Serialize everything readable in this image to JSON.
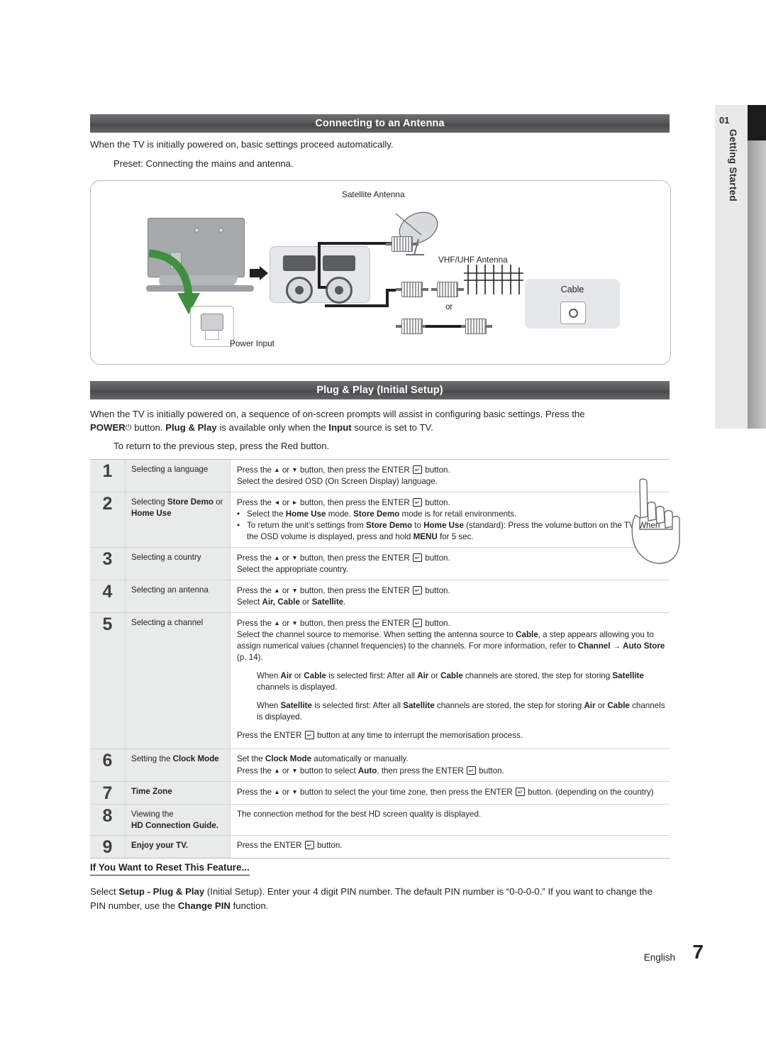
{
  "chapter": {
    "number": "01",
    "label": "Getting Started"
  },
  "sections": {
    "antenna": {
      "title": "Connecting to an Antenna",
      "intro": "When the TV is initially powered on, basic settings proceed automatically.",
      "preset": "Preset: Connecting the mains and antenna.",
      "diagram": {
        "satellite_antenna": "Satellite Antenna",
        "vhf_uhf_antenna": "VHF/UHF Antenna",
        "cable": "Cable",
        "power_input": "Power Input",
        "or": "or"
      }
    },
    "plugplay": {
      "title": "Plug & Play (Initial Setup)",
      "intro_1": "When the TV is initially powered on, a sequence of on-screen prompts will assist in configuring basic settings. Press the",
      "intro_2a": "POWER",
      "intro_2b": "button.",
      "intro_2c": "Plug & Play",
      "intro_2d": "is available only when the",
      "intro_2e": "Input",
      "intro_2f": "source is set to TV.",
      "return_note": "To return to the previous step, press the Red button."
    }
  },
  "steps": [
    {
      "num": "1",
      "title_html": "Selecting a language",
      "lines": [
        "Press the ▲ or ▼ button, then press the ENTER ↵ button.",
        "Select the desired OSD (On Screen Display) language."
      ]
    },
    {
      "num": "2",
      "title_plain": "Selecting Store Demo or Home Use",
      "lines": [
        "Press the ◄ or ► button, then press the ENTER ↵ button.",
        "• Select the Home Use mode. Store Demo mode is for retail environments.",
        "• To return the unit’s settings from Store Demo to Home Use (standard): Press the volume button on the TV. When the OSD volume is displayed, press and hold MENU for 5 sec."
      ]
    },
    {
      "num": "3",
      "title_plain": "Selecting a country",
      "lines": [
        "Press the ▲ or ▼ button, then press the ENTER ↵ button.",
        "Select the appropriate country."
      ]
    },
    {
      "num": "4",
      "title_plain": "Selecting an antenna",
      "lines": [
        "Press the ▲ or ▼ button, then press the ENTER ↵ button.",
        "Select Air, Cable or Satellite."
      ]
    },
    {
      "num": "5",
      "title_plain": "Selecting a channel",
      "lines": [
        "Press the ▲ or ▼ button, then press the ENTER ↵ button.",
        "Select the channel source to memorise. When setting the antenna source to Cable, a step appears allowing you to assign numerical values (channel frequencies) to the channels. For more information, refer to Channel → Auto Store (p. 14).",
        "When Air or Cable is selected first: After all Air or Cable channels are stored, the step for storing Satellite channels is displayed.",
        "When Satellite is selected first: After all Satellite channels are stored, the step for storing Air or Cable channels is displayed.",
        "Press the ENTER ↵ button at any time to interrupt the memorisation process."
      ]
    },
    {
      "num": "6",
      "title_plain": "Setting the Clock Mode",
      "lines": [
        "Set the Clock Mode automatically or manually.",
        "Press the ▲ or ▼ button to select Auto, then press the ENTER ↵ button."
      ]
    },
    {
      "num": "7",
      "title_plain": "Time Zone",
      "lines": [
        "Press the ▲ or ▼ button to select the your time zone, then press the ENTER ↵ button. (depending on the country)"
      ]
    },
    {
      "num": "8",
      "title_plain": "Viewing the HD Connection Guide.",
      "lines": [
        "The connection method for the best HD screen quality is displayed."
      ]
    },
    {
      "num": "9",
      "title_plain": "Enjoy your TV.",
      "lines": [
        "Press the ENTER ↵ button."
      ]
    }
  ],
  "reset": {
    "title": "If You Want to Reset This Feature...",
    "body_1": "Select",
    "body_2": "Setup - Plug & Play",
    "body_3": "(Initial Setup). Enter your 4 digit PIN number. The default PIN number is “0-0-0-0.” If you want to change the PIN number, use the",
    "body_4": "Change PIN",
    "body_5": "function."
  },
  "footer": {
    "language": "English",
    "page": "7"
  }
}
